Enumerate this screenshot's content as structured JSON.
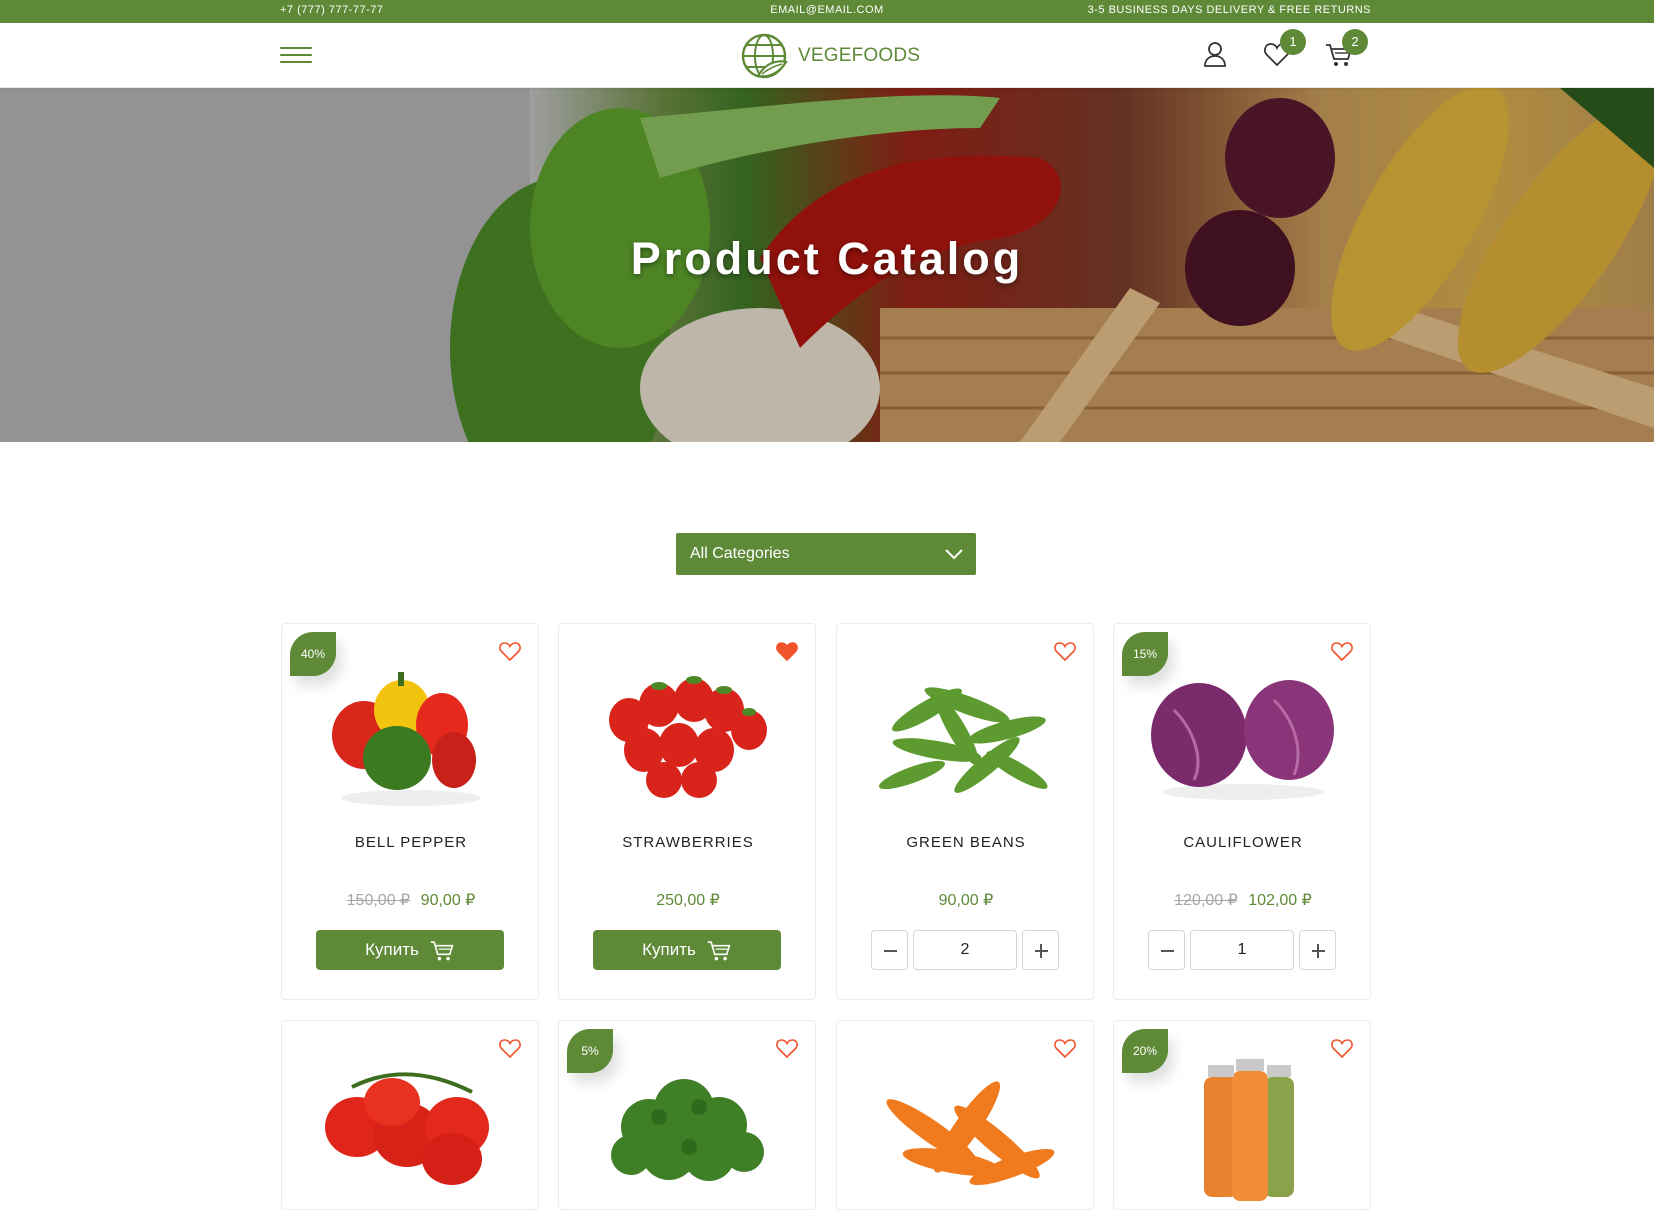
{
  "topbar": {
    "phone": "+7 (777) 777-77-77",
    "email": "EMAIL@EMAIL.COM",
    "delivery": "3-5 BUSINESS DAYS DELIVERY & FREE RETURNS"
  },
  "header": {
    "logo_text": "VEGEFOODS",
    "wishlist_count": "1",
    "cart_count": "2"
  },
  "hero": {
    "title": "Product Catalog"
  },
  "filter": {
    "category_selected": "All Categories"
  },
  "colors": {
    "accent": "#5e8a37",
    "heart": "#f0532b",
    "old_price": "#a7a7a7"
  },
  "products": [
    {
      "name": "BELL PEPPER",
      "discount": "40%",
      "old_price": "150,00 ₽",
      "price": "90,00 ₽",
      "favorite": false,
      "action": "buy",
      "buy_label": "Купить"
    },
    {
      "name": "STRAWBERRIES",
      "price": "250,00 ₽",
      "favorite": true,
      "action": "buy",
      "buy_label": "Купить"
    },
    {
      "name": "GREEN BEANS",
      "price": "90,00 ₽",
      "favorite": false,
      "action": "qty",
      "quantity": "2"
    },
    {
      "name": "CAULIFLOWER",
      "discount": "15%",
      "old_price": "120,00 ₽",
      "price": "102,00 ₽",
      "favorite": false,
      "action": "qty",
      "quantity": "1"
    },
    {
      "name": "",
      "favorite": false,
      "image": "tomatoes"
    },
    {
      "name": "",
      "discount": "5%",
      "favorite": false,
      "image": "broccoli"
    },
    {
      "name": "",
      "favorite": false,
      "image": "carrots"
    },
    {
      "name": "",
      "discount": "20%",
      "favorite": false,
      "image": "juice-bottles"
    }
  ]
}
